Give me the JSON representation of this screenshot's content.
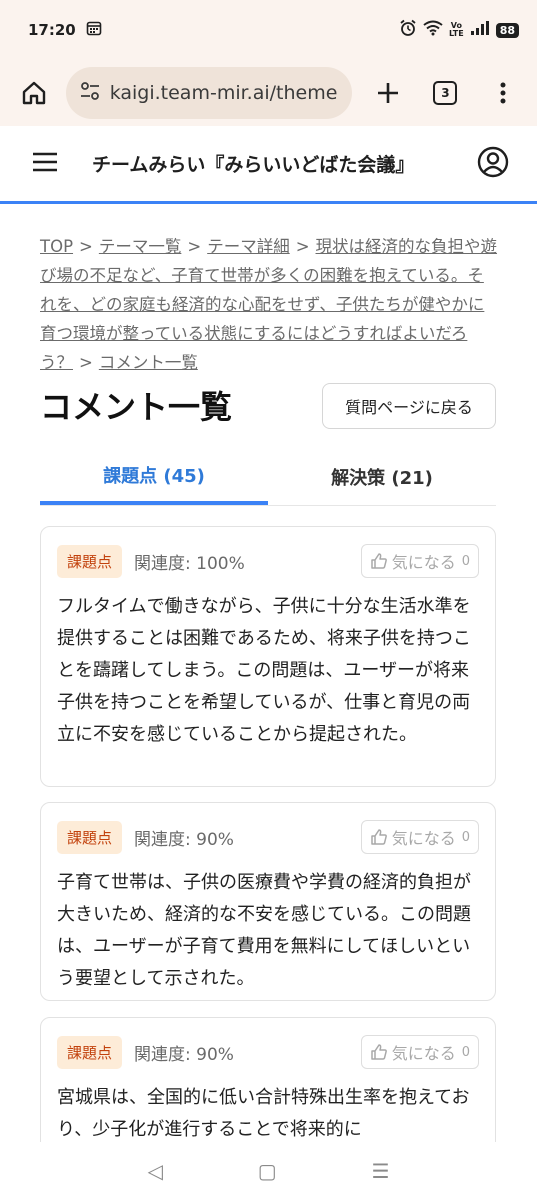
{
  "status_bar": {
    "time": "17:20",
    "volte": "Vo\nLTE",
    "battery": "88"
  },
  "browser": {
    "url": "kaigi.team-mir.ai/themes/e",
    "tab_count": "3"
  },
  "header": {
    "title": "チームみらい『みらいいどばた会議』"
  },
  "breadcrumb": {
    "items": [
      "TOP",
      "テーマ一覧",
      "テーマ詳細",
      "現状は経済的な負担や遊び場の不足など、子育て世帯が多くの困難を抱えている。それを、どの家庭も経済的な心配をせず、子供たちが健やかに育つ環境が整っている状態にするにはどうすればよいだろう？",
      "コメント一覧"
    ],
    "separator": ">"
  },
  "page": {
    "title": "コメント一覧",
    "back_label": "質問ページに戻る"
  },
  "tabs": [
    {
      "label": "課題点 (45)",
      "active": true
    },
    {
      "label": "解決策 (21)",
      "active": false
    }
  ],
  "cards": [
    {
      "badge": "課題点",
      "relevance": "関連度: 100%",
      "like_label": "気になる",
      "like_count": "0",
      "text": "フルタイムで働きながら、子供に十分な生活水準を提供することは困難であるため、将来子供を持つことを躊躇してしまう。この問題は、ユーザーが将来子供を持つことを希望しているが、仕事と育児の両立に不安を感じていることから提起された。"
    },
    {
      "badge": "課題点",
      "relevance": "関連度: 90%",
      "like_label": "気になる",
      "like_count": "0",
      "text": "子育て世帯は、子供の医療費や学費の経済的負担が大きいため、経済的な不安を感じている。この問題は、ユーザーが子育て費用を無料にしてほしいという要望として示された。"
    },
    {
      "badge": "課題点",
      "relevance": "関連度: 90%",
      "like_label": "気になる",
      "like_count": "0",
      "text": "宮城県は、全国的に低い合計特殊出生率を抱えており、少子化が進行することで将来的に"
    }
  ],
  "colors": {
    "accent": "#3b82f6",
    "badge_bg": "#fdecd8",
    "badge_text": "#c2410c",
    "chrome_bg": "#fbf3ee"
  },
  "nav": {
    "back": "◁",
    "home": "▢",
    "recents": "☰"
  }
}
